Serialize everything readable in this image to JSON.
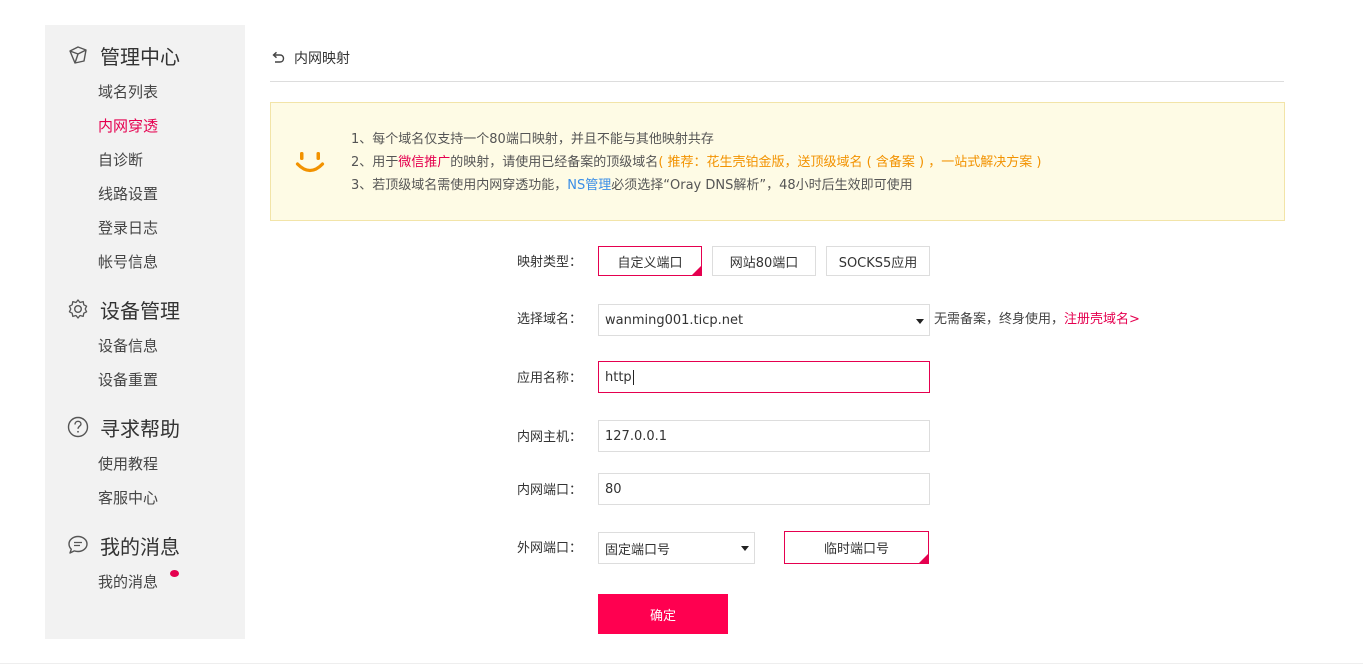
{
  "sidebar": {
    "groups": [
      {
        "title": "管理中心",
        "icon": "cube-icon",
        "items": [
          "域名列表",
          "内网穿透",
          "自诊断",
          "线路设置",
          "登录日志",
          "帐号信息"
        ]
      },
      {
        "title": "设备管理",
        "icon": "gear-icon",
        "items": [
          "设备信息",
          "设备重置"
        ]
      },
      {
        "title": "寻求帮助",
        "icon": "help-icon",
        "items": [
          "使用教程",
          "客服中心"
        ]
      },
      {
        "title": "我的消息",
        "icon": "chat-bubble-icon",
        "items": [
          "我的消息"
        ]
      }
    ],
    "active_item": "内网穿透"
  },
  "breadcrumb": {
    "title": "内网映射",
    "icon": "back-arrow-icon"
  },
  "notice": {
    "icon": "smile-icon",
    "line1": "1、每个域名仅支持一个80端口映射，并且不能与其他映射共存",
    "line2_a": "2、用于",
    "line2_red": "微信推广",
    "line2_b": "的映射，请使用已经备案的顶级域名",
    "line2_orange": "( 推荐：花生壳铂金版，送顶级域名 ( 含备案 ) ，一站式解决方案 )",
    "line3_a": "3、若顶级域名需使用内网穿透功能，",
    "line3_blue": "NS管理",
    "line3_b": "必须选择“Oray DNS解析”，48小时后生效即可使用"
  },
  "form": {
    "map_type_label": "映射类型：",
    "map_types": [
      "自定义端口",
      "网站80端口",
      "SOCKS5应用"
    ],
    "selected_map_type": "自定义端口",
    "domain_label": "选择域名：",
    "domain_value": "wanming001.ticp.net",
    "domain_tip": "无需备案，终身使用，",
    "domain_tip_link": "注册壳域名>",
    "app_name_label": "应用名称：",
    "app_name_value": "http",
    "host_label": "内网主机：",
    "host_value": "127.0.0.1",
    "port_label": "内网端口：",
    "port_value": "80",
    "ext_port_label": "外网端口：",
    "ext_port_mode": "固定端口号",
    "temp_port_button": "临时端口号",
    "submit_label": "确定"
  },
  "colors": {
    "accent": "#e5004f",
    "button": "#ff0050",
    "notice_bg": "#fefbe5",
    "orange": "#f29200",
    "link_blue": "#3a8ee6"
  }
}
